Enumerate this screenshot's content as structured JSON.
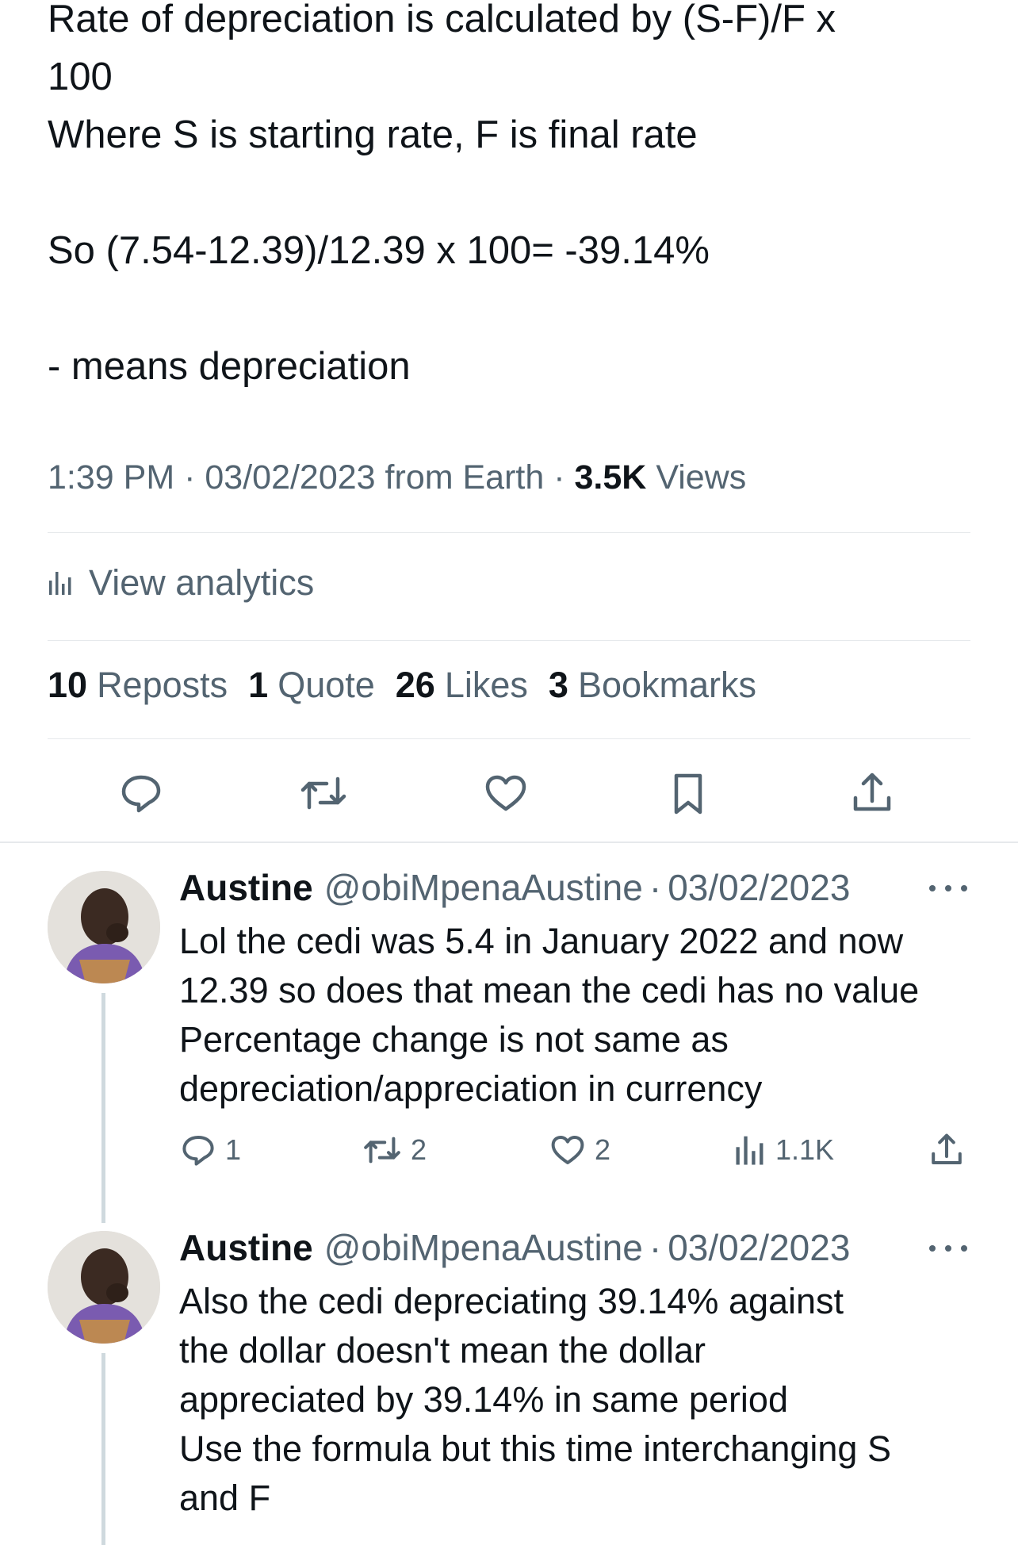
{
  "tweet": {
    "lines": [
      "Rate of depreciation is calculated by (S-F)/F x",
      "100",
      "Where S is starting rate, F is final rate",
      "",
      "So (7.54-12.39)/12.39 x 100= -39.14%",
      "",
      "- means depreciation"
    ],
    "time": "1:39 PM",
    "date": "03/02/2023",
    "source": "from Earth",
    "views_count": "3.5K",
    "views_label": "Views"
  },
  "analytics": {
    "label": "View analytics",
    "icon": "bar-chart-icon"
  },
  "stats": {
    "reposts_count": "10",
    "reposts_label": "Reposts",
    "quotes_count": "1",
    "quotes_label": "Quote",
    "likes_count": "26",
    "likes_label": "Likes",
    "bookmarks_count": "3",
    "bookmarks_label": "Bookmarks"
  },
  "actions": [
    "reply-icon",
    "repost-icon",
    "like-icon",
    "bookmark-icon",
    "share-icon"
  ],
  "replies": [
    {
      "name": "Austine",
      "handle": "@obiMpenaAustine",
      "date": "03/02/2023",
      "lines": [
        "Lol the cedi was 5.4 in January 2022 and now",
        "12.39 so does that mean the cedi has no value",
        "Percentage change is not same as",
        "depreciation/appreciation in currency"
      ],
      "reply_count": "1",
      "repost_count": "2",
      "like_count": "2",
      "view_count": "1.1K"
    },
    {
      "name": "Austine",
      "handle": "@obiMpenaAustine",
      "date": "03/02/2023",
      "lines": [
        "Also the cedi depreciating 39.14% against",
        "the dollar doesn't mean the dollar",
        "appreciated by 39.14% in same period",
        "Use the formula but this time interchanging S",
        "and F"
      ]
    }
  ],
  "colors": {
    "text": "#0f1419",
    "secondary": "#536471",
    "divider": "#e6e9ec",
    "thread": "#cfd9de"
  }
}
